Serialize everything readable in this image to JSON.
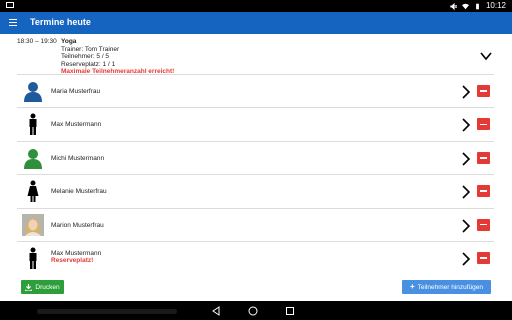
{
  "appbar": {
    "title": "Termine heute",
    "menu_icon": "hamburger-menu-icon"
  },
  "status_bar": {
    "time": "10:12",
    "icons": [
      "mute-icon",
      "wifi-icon",
      "battery-icon"
    ]
  },
  "course": {
    "time": "18:30 – 19:30",
    "name": "Yoga",
    "trainer": "Trainer: Tom Trainer",
    "participants": "Teilnehmer: 5 / 5",
    "reserve": "Reserveplatz: 1 / 1",
    "warning": "Maximale Teilnehmeranzahl erreicht!"
  },
  "participants": [
    {
      "name": "Maria Musterfrau",
      "avatar": "person-blue-avatar-icon",
      "note": ""
    },
    {
      "name": "Max Mustermann",
      "avatar": "male-figure-icon",
      "note": ""
    },
    {
      "name": "Michi Mustermann",
      "avatar": "person-green-avatar-icon",
      "note": ""
    },
    {
      "name": "Melanie Musterfrau",
      "avatar": "female-figure-icon",
      "note": ""
    },
    {
      "name": "Marion Musterfrau",
      "avatar": "photo-avatar",
      "note": ""
    },
    {
      "name": "Max Mustermann",
      "avatar": "male-figure-icon",
      "note": "Reserveplatz!"
    }
  ],
  "buttons": {
    "print": "Drucken",
    "add": "Teilnehmer hinzufügen"
  },
  "colors": {
    "primary": "#1565c0",
    "danger": "#e53935",
    "success": "#2e9e3a",
    "accent": "#4a90e2"
  }
}
